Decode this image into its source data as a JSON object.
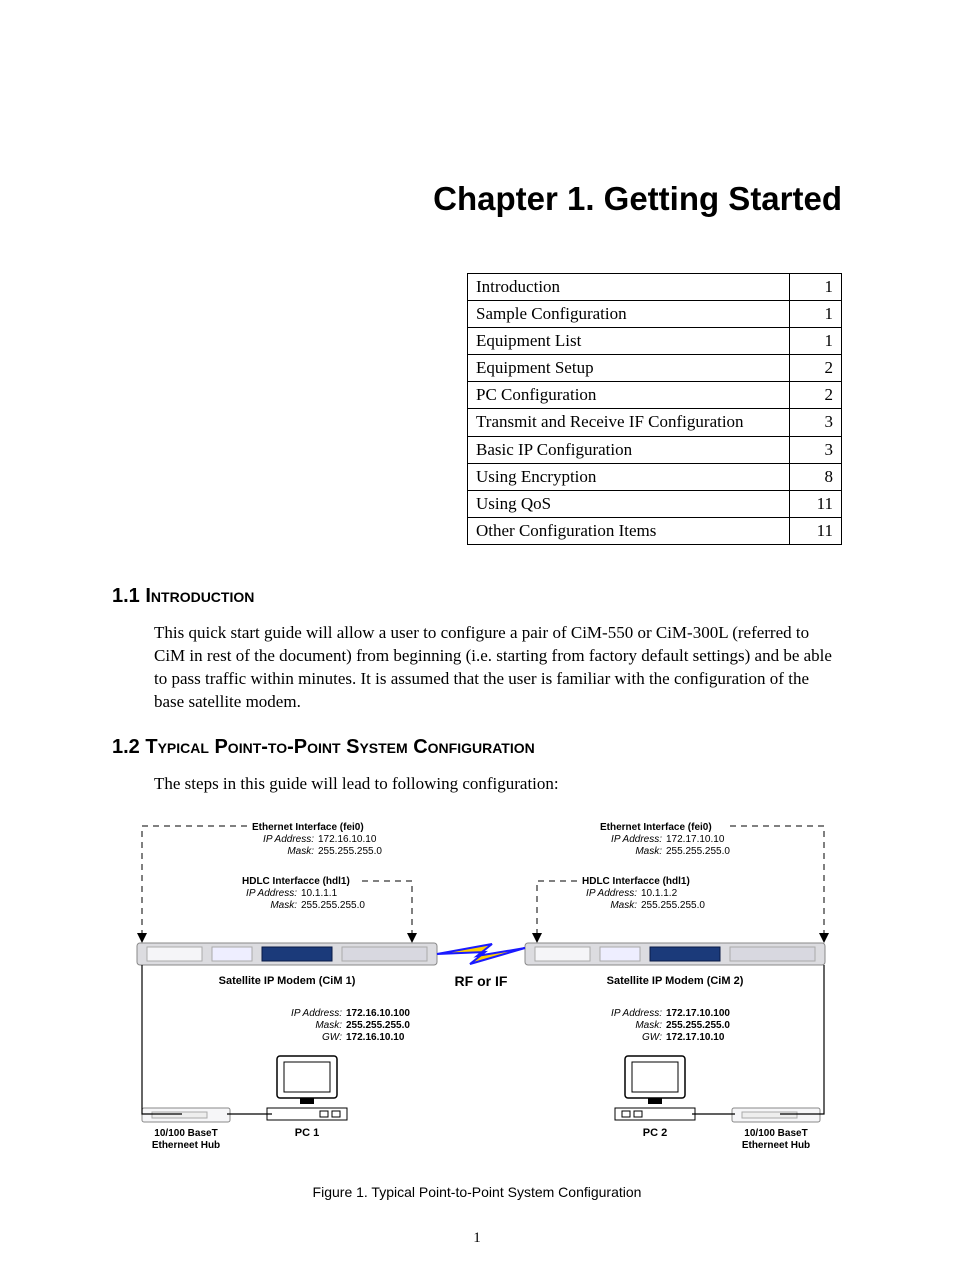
{
  "chapter_title": "Chapter 1. Getting Started",
  "toc": [
    {
      "label": "Introduction",
      "page": "1"
    },
    {
      "label": "Sample Configuration",
      "page": "1"
    },
    {
      "label": "Equipment List",
      "page": "1"
    },
    {
      "label": "Equipment Setup",
      "page": "2"
    },
    {
      "label": "PC Configuration",
      "page": "2"
    },
    {
      "label": "Transmit and Receive IF Configuration",
      "page": "3"
    },
    {
      "label": "Basic IP Configuration",
      "page": "3"
    },
    {
      "label": "Using Encryption",
      "page": "8"
    },
    {
      "label": "Using QoS",
      "page": "11"
    },
    {
      "label": "Other Configuration Items",
      "page": "11"
    }
  ],
  "section_1_1": {
    "heading": "1.1 Introduction",
    "body": "This quick start guide will allow a user to configure a pair of CiM-550 or CiM-300L (referred to CiM in rest of the document) from beginning (i.e. starting from factory default settings) and be able to pass traffic within minutes. It is assumed that the user is familiar with the configuration of the base satellite modem."
  },
  "section_1_2": {
    "heading": "1.2 Typical Point-to-Point System Configuration",
    "body": "The steps in this guide will lead to following configuration:"
  },
  "figure": {
    "caption": "Figure 1.  Typical Point-to-Point System Configuration",
    "left": {
      "eth_label": "Ethernet Interface (fei0)",
      "eth_ip_label": "IP Address:",
      "eth_ip": "172.16.10.10",
      "eth_mask_label": "Mask:",
      "eth_mask": "255.255.255.0",
      "hdlc_label": "HDLC Interfacce (hdl1)",
      "hdlc_ip_label": "IP Address:",
      "hdlc_ip": "10.1.1.1",
      "hdlc_mask_label": "Mask:",
      "hdlc_mask": "255.255.255.0",
      "modem_label": "Satellite IP Modem (CiM 1)",
      "pc_ip_label": "IP Address:",
      "pc_ip": "172.16.10.100",
      "pc_mask_label": "Mask:",
      "pc_mask": "255.255.255.0",
      "pc_gw_label": "GW:",
      "pc_gw": "172.16.10.10",
      "pc_label": "PC 1",
      "hub_label": "10/100 BaseT Etherneet Hub"
    },
    "right": {
      "eth_label": "Ethernet Interface (fei0)",
      "eth_ip_label": "IP Address:",
      "eth_ip": "172.17.10.10",
      "eth_mask_label": "Mask:",
      "eth_mask": "255.255.255.0",
      "hdlc_label": "HDLC Interfacce (hdl1)",
      "hdlc_ip_label": "IP Address:",
      "hdlc_ip": "10.1.1.2",
      "hdlc_mask_label": "Mask:",
      "hdlc_mask": "255.255.255.0",
      "modem_label": "Satellite IP Modem (CiM 2)",
      "pc_ip_label": "IP Address:",
      "pc_ip": "172.17.10.100",
      "pc_mask_label": "Mask:",
      "pc_mask": "255.255.255.0",
      "pc_gw_label": "GW:",
      "pc_gw": "172.17.10.10",
      "pc_label": "PC 2",
      "hub_label": "10/100 BaseT Etherneet Hub"
    },
    "center_label": "RF or IF"
  },
  "page_number": "1"
}
